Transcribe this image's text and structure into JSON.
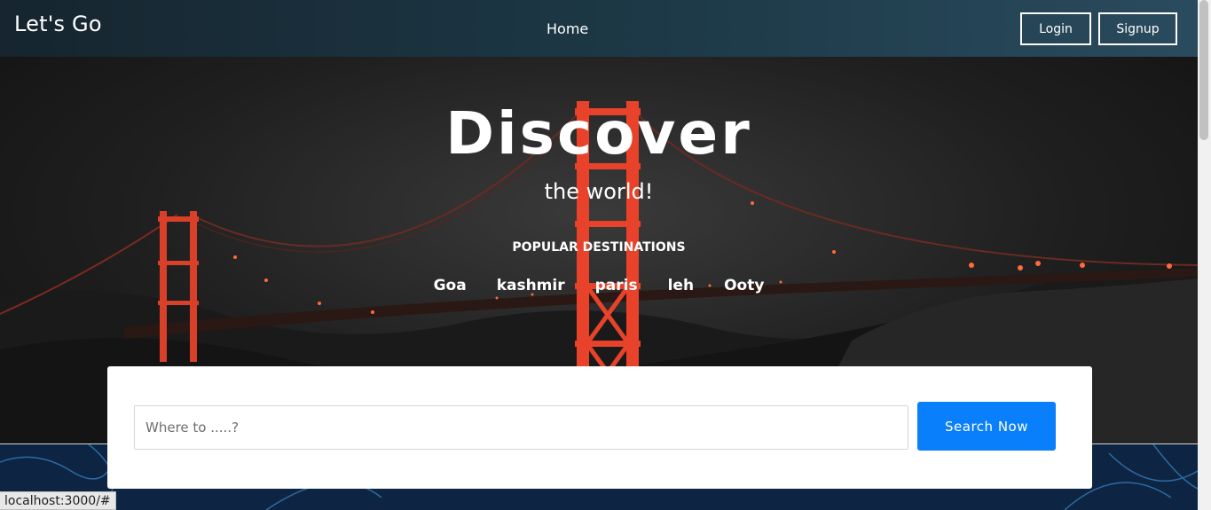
{
  "navbar": {
    "brand": "Let's Go",
    "home": "Home",
    "login": "Login",
    "signup": "Signup"
  },
  "hero": {
    "title": "Discover",
    "subtitle": "the world!",
    "popular_heading": "POPULAR DESTINATIONS",
    "destinations": [
      "Goa",
      "kashmir",
      "paris",
      "leh",
      "Ooty"
    ],
    "image_icon": "golden-gate-bridge-night-photo"
  },
  "search": {
    "placeholder": "Where to .....?",
    "value": "",
    "button": "Search Now"
  },
  "status_bar": {
    "url": "localhost:3000/#"
  },
  "colors": {
    "accent": "#0a7ffb",
    "bridge": "#e8432a",
    "pattern_bg": "#0d2542",
    "pattern_lines": "#2d6aa3"
  }
}
